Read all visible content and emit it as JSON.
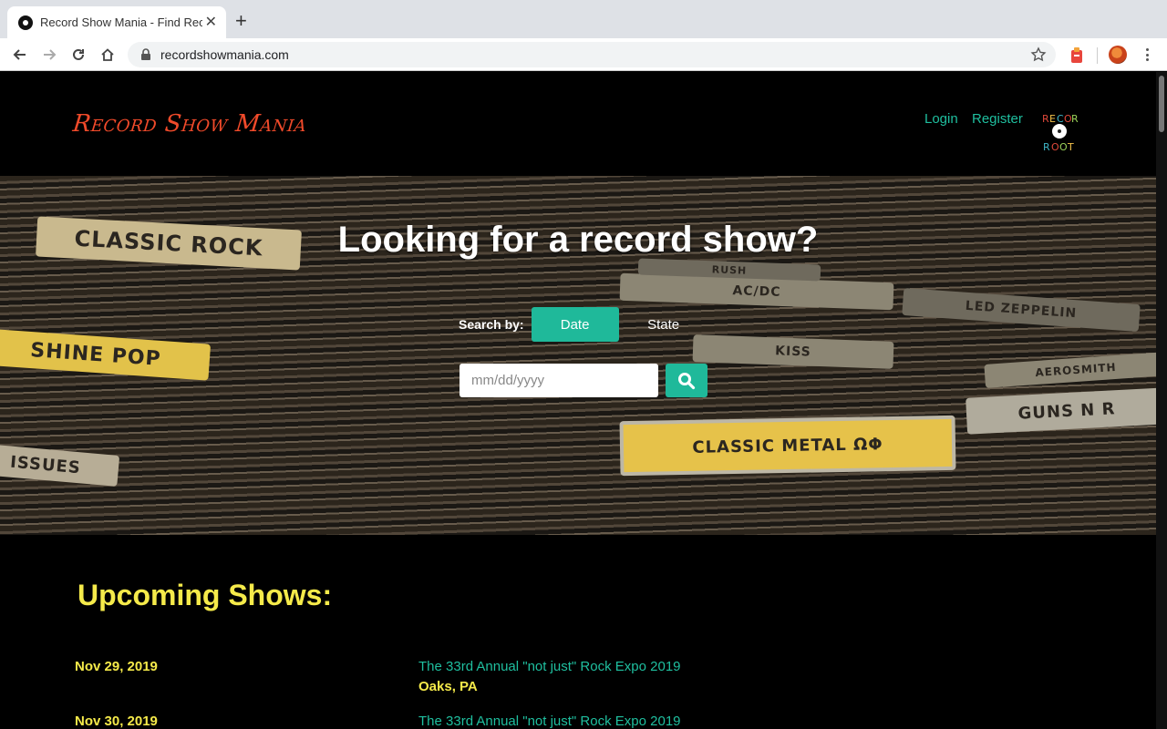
{
  "browser": {
    "tab_title": "Record Show Mania - Find Record Shows",
    "url": "recordshowmania.com",
    "new_tab_glyph": "+",
    "close_glyph": "✕"
  },
  "header": {
    "logo_text": "Record Show Mania",
    "nav": {
      "login": "Login",
      "register": "Register"
    },
    "partner_logo_text": "RECORD ROOTS"
  },
  "hero": {
    "title": "Looking for a record show?",
    "search_by_label": "Search by:",
    "options": {
      "date": "Date",
      "state": "State"
    },
    "date_placeholder": "mm/dd/yyyy",
    "bin_labels": [
      "CLASSIC ROCK",
      "SHINE POP",
      "ISSUES",
      "AC/DC",
      "KISS",
      "LED ZEPPELIN",
      "CLASSIC METAL ΩΦ",
      "GUNS N R",
      "AEROSMITH",
      "RUSH"
    ]
  },
  "upcoming": {
    "title": "Upcoming Shows:",
    "shows": [
      {
        "date": "Nov 29, 2019",
        "name": "The 33rd Annual \"not just\" Rock Expo 2019",
        "location": "Oaks, PA"
      },
      {
        "date": "Nov 30, 2019",
        "name": "The 33rd Annual \"not just\" Rock Expo 2019",
        "location": ""
      }
    ]
  },
  "colors": {
    "accent": "#1fb99a",
    "link": "#1fbf9f",
    "highlight": "#f5ea4a",
    "logo": "#f04a2a"
  },
  "icons": {
    "back": "arrow-left-icon",
    "forward": "arrow-right-icon",
    "reload": "reload-icon",
    "home": "home-icon",
    "lock": "lock-icon",
    "star": "star-icon",
    "search": "search-icon"
  }
}
